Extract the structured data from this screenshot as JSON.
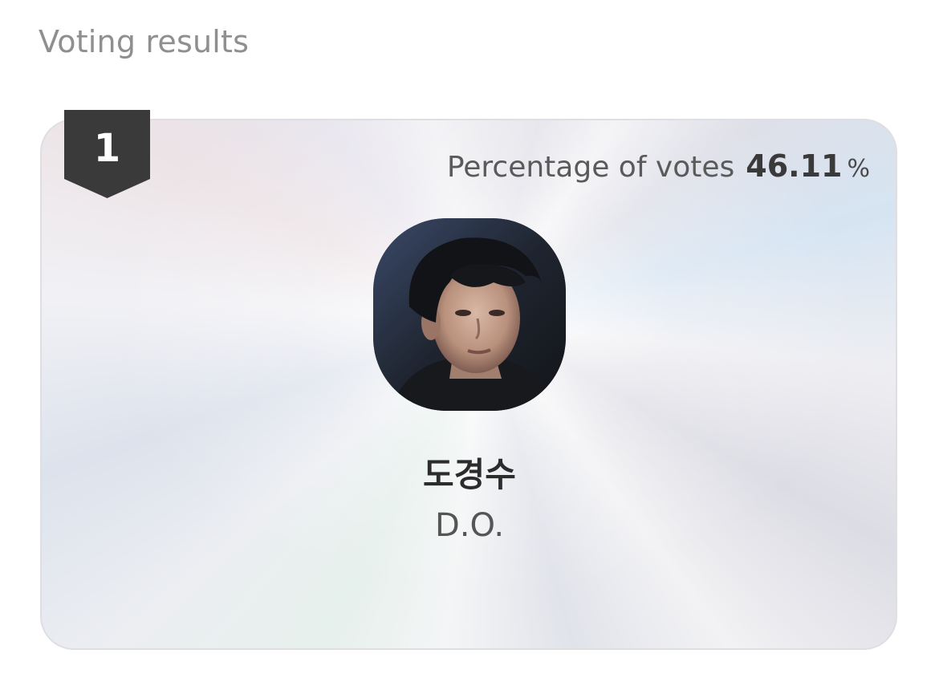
{
  "header": {
    "title": "Voting results"
  },
  "result": {
    "rank": "1",
    "percentage_label": "Percentage of votes",
    "percentage_value": "46.11",
    "percentage_unit": "%",
    "name_korean": "도경수",
    "name_english": "D.O.",
    "avatar_alt": "member-photo"
  },
  "colors": {
    "badge": "#3a3a3a",
    "card_border": "#dedee3",
    "title_text": "#8f8f8f"
  }
}
